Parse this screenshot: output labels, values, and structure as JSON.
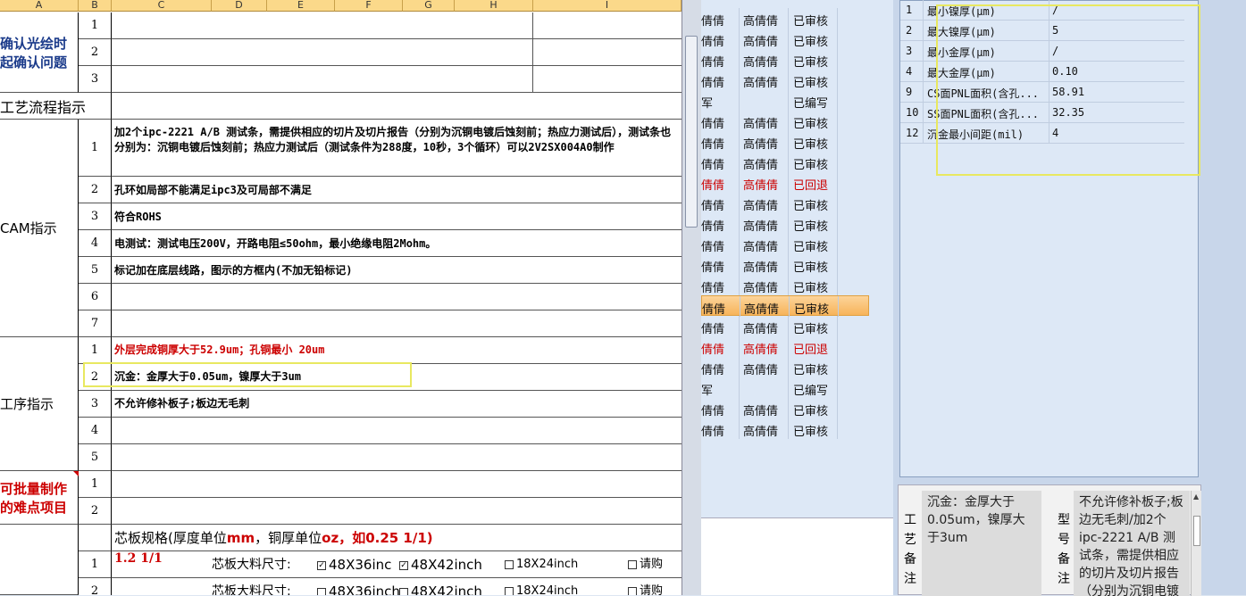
{
  "columns": [
    "A",
    "B",
    "C",
    "D",
    "E",
    "F",
    "G",
    "H",
    "I"
  ],
  "sections": {
    "confirm": "确认光绘时\n起确认问题",
    "process_flow": "工艺流程指示",
    "cam": "CAM指示",
    "procedure": "工序指示",
    "difficulty": "可批量制作\n的难点项目"
  },
  "confirm_rows": [
    "1",
    "2",
    "3"
  ],
  "cam_rows": [
    {
      "n": "1",
      "text": "加2个ipc-2221 A/B 测试条，需提供相应的切片及切片报告（分别为沉铜电镀后蚀刻前；热应力测试后），测试条也分别为：沉铜电镀后蚀刻前；热应力测试后（测试条件为288度，10秒，3个循环）可以2V2SX004A0制作"
    },
    {
      "n": "2",
      "text": "孔环如局部不能满足ipc3及可局部不满足"
    },
    {
      "n": "3",
      "text": "符合ROHS"
    },
    {
      "n": "4",
      "text": "电测试：测试电压200V，开路电阻≤50ohm，最小绝缘电阻2Mohm。"
    },
    {
      "n": "5",
      "text": "标记加在底层线路，图示的方框内(不加无铅标记)"
    },
    {
      "n": "6",
      "text": ""
    },
    {
      "n": "7",
      "text": ""
    }
  ],
  "proc_rows": [
    {
      "n": "1",
      "text": "外层完成铜厚大于52.9um；孔铜最小 20um"
    },
    {
      "n": "2",
      "text": "沉金：金厚大于0.05um，镍厚大于3um"
    },
    {
      "n": "3",
      "text": "不允许修补板子;板边无毛刺"
    },
    {
      "n": "4",
      "text": ""
    },
    {
      "n": "5",
      "text": ""
    }
  ],
  "diff_rows": [
    "1",
    "2"
  ],
  "core_spec": {
    "title_a": "芯板规格(厚度单位",
    "unit_mm": "mm",
    "title_b": "，铜厚单位",
    "unit_oz": "oz",
    "title_c": "，如0.25 1/1)"
  },
  "core_rows": [
    {
      "n": "1",
      "val": "1.2 1/1",
      "label": "芯板大料尺寸:",
      "o1": "48X36inc",
      "o2": "48X42inch",
      "o3": "18X24inch",
      "o4": "请购"
    },
    {
      "n": "2",
      "val": "",
      "label": "芯板大料尺寸:",
      "o1": "48X36inch",
      "o2": "48X42inch",
      "o3": "18X24inch",
      "o4": "请购"
    }
  ],
  "list_rows": [
    {
      "a": "倩倩",
      "b": "高倩倩",
      "c": "已审核",
      "red": false,
      "sel": false
    },
    {
      "a": "倩倩",
      "b": "高倩倩",
      "c": "已审核",
      "red": false,
      "sel": false
    },
    {
      "a": "倩倩",
      "b": "高倩倩",
      "c": "已审核",
      "red": false,
      "sel": false
    },
    {
      "a": "倩倩",
      "b": "高倩倩",
      "c": "已审核",
      "red": false,
      "sel": false
    },
    {
      "a": "军",
      "b": "",
      "c": "已编写",
      "red": false,
      "sel": false
    },
    {
      "a": "倩倩",
      "b": "高倩倩",
      "c": "已审核",
      "red": false,
      "sel": false
    },
    {
      "a": "倩倩",
      "b": "高倩倩",
      "c": "已审核",
      "red": false,
      "sel": false
    },
    {
      "a": "倩倩",
      "b": "高倩倩",
      "c": "已审核",
      "red": false,
      "sel": false
    },
    {
      "a": "倩倩",
      "b": "高倩倩",
      "c": "已回退",
      "red": true,
      "sel": false
    },
    {
      "a": "倩倩",
      "b": "高倩倩",
      "c": "已审核",
      "red": false,
      "sel": false
    },
    {
      "a": "倩倩",
      "b": "高倩倩",
      "c": "已审核",
      "red": false,
      "sel": false
    },
    {
      "a": "倩倩",
      "b": "高倩倩",
      "c": "已审核",
      "red": false,
      "sel": false
    },
    {
      "a": "倩倩",
      "b": "高倩倩",
      "c": "已审核",
      "red": false,
      "sel": false
    },
    {
      "a": "倩倩",
      "b": "高倩倩",
      "c": "已审核",
      "red": false,
      "sel": false
    },
    {
      "a": "倩倩",
      "b": "高倩倩",
      "c": "已审核",
      "red": false,
      "sel": true
    },
    {
      "a": "倩倩",
      "b": "高倩倩",
      "c": "已审核",
      "red": false,
      "sel": false
    },
    {
      "a": "倩倩",
      "b": "高倩倩",
      "c": "已回退",
      "red": true,
      "sel": false
    },
    {
      "a": "倩倩",
      "b": "高倩倩",
      "c": "已审核",
      "red": false,
      "sel": false
    },
    {
      "a": "军",
      "b": "",
      "c": "已编写",
      "red": false,
      "sel": false
    },
    {
      "a": "倩倩",
      "b": "高倩倩",
      "c": "已审核",
      "red": false,
      "sel": false
    },
    {
      "a": "倩倩",
      "b": "高倩倩",
      "c": "已审核",
      "red": false,
      "sel": false
    }
  ],
  "params": [
    {
      "id": "1",
      "name": "最小镍厚(μm)",
      "val": "/"
    },
    {
      "id": "2",
      "name": "最大镍厚(μm)",
      "val": "5"
    },
    {
      "id": "3",
      "name": "最小金厚(μm)",
      "val": "/"
    },
    {
      "id": "4",
      "name": "最大金厚(μm)",
      "val": "0.10"
    },
    {
      "id": "9",
      "name": "CS面PNL面积(含孔...",
      "val": "58.91"
    },
    {
      "id": "10",
      "name": "SS面PNL面积(含孔...",
      "val": "32.35"
    },
    {
      "id": "12",
      "name": "沉金最小间距(mil)",
      "val": "4"
    }
  ],
  "notes": {
    "left_label": "工艺备注",
    "left_text": "沉金：金厚大于0.05um，镍厚大于3um",
    "right_label": "型号备注",
    "right_text": "不允许修补板子;板边无毛刺/加2个ipc-2221 A/B 测试条，需提供相应的切片及切片报告（分别为沉铜电镀"
  },
  "colors": {
    "header": "#fbd98a",
    "highlight": "#e8e860",
    "selected_row": "#f7b45a",
    "red_text": "#cc0000"
  }
}
